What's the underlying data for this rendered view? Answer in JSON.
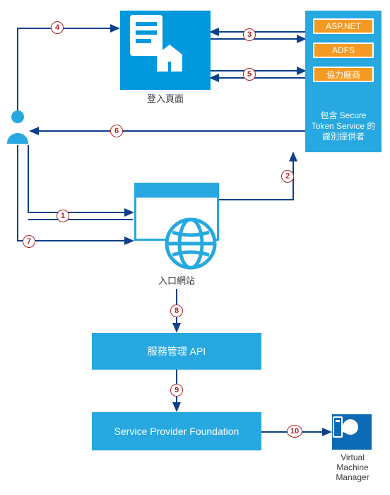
{
  "nodes": {
    "login_page": {
      "label": "登入頁面"
    },
    "identity_provider": {
      "label": "包含 Secure Token Service 的識別提供者",
      "items": [
        "ASP.NET",
        "ADFS",
        "協力廠商"
      ]
    },
    "portal": {
      "label": "入口網站"
    },
    "api": {
      "label": "服務管理 API"
    },
    "spf": {
      "label": "Service Provider Foundation"
    },
    "vmm": {
      "label": "Virtual Machine Manager"
    }
  },
  "steps": [
    "1",
    "2",
    "3",
    "4",
    "5",
    "6",
    "7",
    "8",
    "9",
    "10"
  ]
}
